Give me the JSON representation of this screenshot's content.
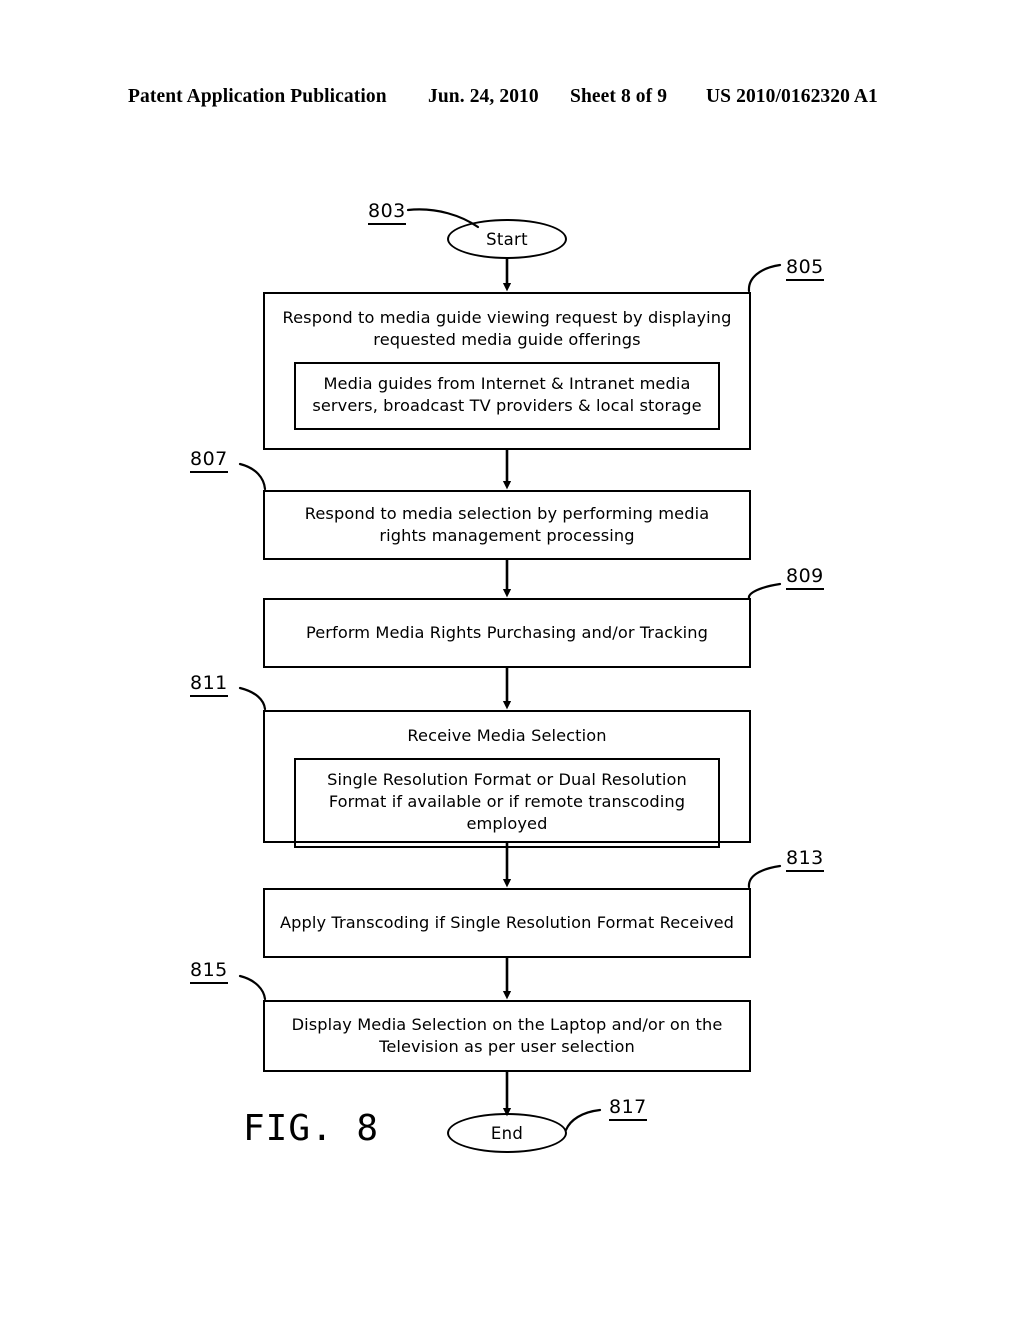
{
  "header": {
    "publication": "Patent Application Publication",
    "date": "Jun. 24, 2010",
    "sheet": "Sheet 8 of 9",
    "patent_number": "US 2010/0162320 A1"
  },
  "figure": {
    "caption": "FIG. 8",
    "start_label": "Start",
    "end_label": "End"
  },
  "refs": {
    "start": "803",
    "step1": "805",
    "step2": "807",
    "step3": "809",
    "step4": "811",
    "step5": "813",
    "step6": "815",
    "end": "817"
  },
  "nodes": {
    "step1": {
      "title": "Respond to media guide viewing request by displaying requested media guide offerings",
      "inner": "Media guides from Internet & Intranet media servers, broadcast TV providers & local storage"
    },
    "step2": {
      "title": "Respond to media selection by performing media rights management processing"
    },
    "step3": {
      "title": "Perform Media Rights Purchasing and/or Tracking"
    },
    "step4": {
      "title": "Receive Media Selection",
      "inner": "Single Resolution Format or Dual Resolution Format if available or if remote transcoding employed"
    },
    "step5": {
      "title": "Apply Transcoding if Single Resolution Format Received"
    },
    "step6": {
      "title": "Display Media Selection on the Laptop and/or on the Television as per user selection"
    }
  },
  "colors": {
    "ink": "#000000",
    "paper": "#ffffff"
  }
}
